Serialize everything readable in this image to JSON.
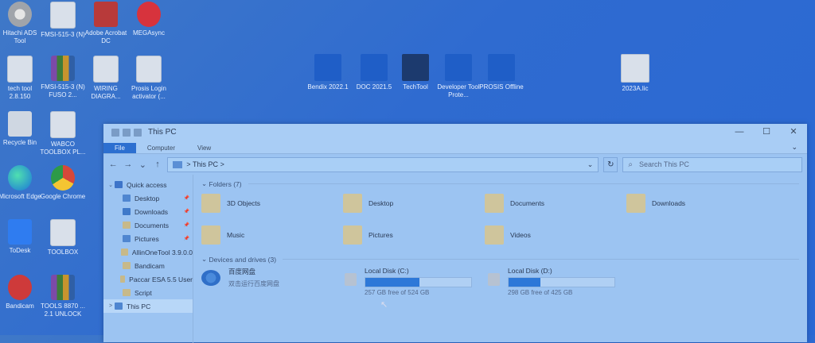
{
  "desktop_left": [
    {
      "label": "Hitachi ADS Tool",
      "icon": "gear-icon",
      "cls": "gear"
    },
    {
      "label": "FMSI-515-3 (N)",
      "icon": "file-icon",
      "cls": "file"
    },
    {
      "label": "Adobe Acrobat DC",
      "icon": "pdf-icon",
      "cls": "pdf"
    },
    {
      "label": "MEGAsync",
      "icon": "mega-icon",
      "cls": "mega"
    },
    {
      "label": "tech tool 2.8.150",
      "icon": "file-icon",
      "cls": "file"
    },
    {
      "label": "FMSI-515-3 (N) FUSO 2...",
      "icon": "archive-icon",
      "cls": "zip"
    },
    {
      "label": "WIRING DIAGRA...",
      "icon": "file-icon",
      "cls": "file"
    },
    {
      "label": "Prosis Login activator (...",
      "icon": "file-icon",
      "cls": "file"
    },
    {
      "label": "Recycle Bin",
      "icon": "recycle-bin-icon",
      "cls": "recycle"
    },
    {
      "label": "WABCO TOOLBOX PL...",
      "icon": "file-icon",
      "cls": "file"
    },
    {
      "label": "Microsoft Edge",
      "icon": "edge-icon",
      "cls": "edge"
    },
    {
      "label": "Google Chrome",
      "icon": "chrome-icon",
      "cls": "chrome"
    },
    {
      "label": "ToDesk",
      "icon": "todesk-icon",
      "cls": "todesk"
    },
    {
      "label": "TOOLBOX",
      "icon": "file-icon",
      "cls": "file"
    },
    {
      "label": "Bandicam",
      "icon": "bandicam-icon",
      "cls": "bandicam"
    },
    {
      "label": "TOOLS 8870 ... 2.1 UNLOCK",
      "icon": "archive-icon",
      "cls": "zip"
    }
  ],
  "desktop_mid": [
    {
      "label": "Bendix 2022.1",
      "icon": "bendix-icon",
      "cls": "blue"
    },
    {
      "label": "DOC 2021.5",
      "icon": "doc-icon",
      "cls": "blue"
    },
    {
      "label": "TechTool",
      "icon": "techtool-icon",
      "cls": "dark"
    },
    {
      "label": "Developer Tool Prote...",
      "icon": "developer-tool-icon",
      "cls": "blue"
    },
    {
      "label": "PROSIS Offline",
      "icon": "prosis-icon",
      "cls": "blue"
    },
    {
      "label": "2023A.lic",
      "icon": "file-icon",
      "cls": "file"
    }
  ],
  "window": {
    "title": "This PC",
    "controls": {
      "minimize": "—",
      "maximize": "☐",
      "close": "✕"
    },
    "ribbon_tabs": [
      "File",
      "Computer",
      "View"
    ],
    "address": {
      "path": "This PC",
      "sep": ">",
      "back": "←",
      "forward": "→",
      "down": "⌄",
      "up": "↑",
      "dropdown": "⌄",
      "refresh": "↻"
    },
    "search_placeholder": "Search This PC",
    "nav": [
      {
        "label": "Quick access",
        "icon": "star",
        "exp": "⌄",
        "pin": false,
        "selected": false,
        "indent": 0
      },
      {
        "label": "Desktop",
        "icon": "blue",
        "exp": "",
        "pin": true,
        "selected": false,
        "indent": 1
      },
      {
        "label": "Downloads",
        "icon": "down",
        "exp": "",
        "pin": true,
        "selected": false,
        "indent": 1
      },
      {
        "label": "Documents",
        "icon": "folder",
        "exp": "",
        "pin": true,
        "selected": false,
        "indent": 1
      },
      {
        "label": "Pictures",
        "icon": "blue",
        "exp": "",
        "pin": true,
        "selected": false,
        "indent": 1
      },
      {
        "label": "AllinOneTool 3.9.0.0",
        "icon": "folder",
        "exp": "",
        "pin": false,
        "selected": false,
        "indent": 1
      },
      {
        "label": "Bandicam",
        "icon": "folder",
        "exp": "",
        "pin": false,
        "selected": false,
        "indent": 1
      },
      {
        "label": "Paccar ESA 5.5 User",
        "icon": "folder",
        "exp": "",
        "pin": false,
        "selected": false,
        "indent": 1
      },
      {
        "label": "Script",
        "icon": "folder",
        "exp": "",
        "pin": false,
        "selected": false,
        "indent": 1
      },
      {
        "label": "This PC",
        "icon": "blue",
        "exp": ">",
        "pin": false,
        "selected": true,
        "indent": 0
      }
    ],
    "folders_header": "Folders (7)",
    "folders": [
      "3D Objects",
      "Desktop",
      "Documents",
      "Downloads",
      "Music",
      "Pictures",
      "Videos"
    ],
    "drives_header": "Devices and drives (3)",
    "drives": [
      {
        "name": "百度网盘",
        "sub": "双击运行百度网盘",
        "type": "cloud",
        "used": null
      },
      {
        "name": "Local Disk (C:)",
        "sub": "257 GB free of 524 GB",
        "type": "disk",
        "used": 0.51
      },
      {
        "name": "Local Disk (D:)",
        "sub": "298 GB free of 425 GB",
        "type": "disk",
        "used": 0.3
      }
    ]
  }
}
